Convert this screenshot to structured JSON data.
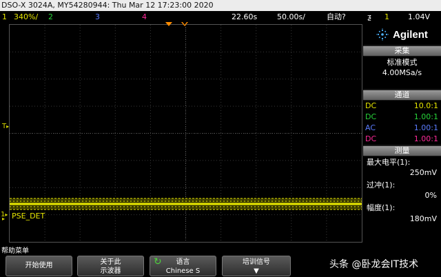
{
  "title": "DSO-X 3024A, MY54280944: Thu Mar 12 17:23:00 2020",
  "status": {
    "ch1_num": "1",
    "ch1_scale": "340%/",
    "ch2_num": "2",
    "ch3_num": "3",
    "ch4_num": "4",
    "time_pos": "22.60s",
    "time_scale": "50.00s/",
    "trigger_mode": "自动?",
    "trigger_icon": "ƺ",
    "trigger_src": "1",
    "trigger_level": "1.04V"
  },
  "screen": {
    "trigger_marker": "T",
    "ch1_marker": "1",
    "signal_label": "PSE_DET"
  },
  "panel": {
    "logo": "Agilent",
    "acq_title": "采集",
    "acq_mode": "标准模式",
    "acq_rate": "4.00MSa/s",
    "chan_title": "通道",
    "channels": [
      {
        "coupling": "DC",
        "ratio": "10.0:1",
        "color": "#e8e800"
      },
      {
        "coupling": "DC",
        "ratio": "1.00:1",
        "color": "#27d63a"
      },
      {
        "coupling": "AC",
        "ratio": "1.00:1",
        "color": "#5b7cff"
      },
      {
        "coupling": "DC",
        "ratio": "1.00:1",
        "color": "#ff2a9a"
      }
    ],
    "meas_title": "测量",
    "meas": [
      {
        "label": "最大电平(1):",
        "value": "250mV"
      },
      {
        "label": "过冲(1):",
        "value": "0%"
      },
      {
        "label": "幅度(1):",
        "value": "180mV"
      }
    ]
  },
  "softkeys": {
    "menu_label": "帮助菜单",
    "key1": "开始使用",
    "key2_line1": "关于此",
    "key2_line2": "示波器",
    "key3_line1": "语言",
    "key3_line2": "Chinese S",
    "key4_line1": "培训信号",
    "key4_arrow": "▼"
  },
  "watermark": "头条 @卧龙会IT技术",
  "colors": {
    "ch1": "#e8e800",
    "ch2": "#27d63a",
    "ch3": "#5b7cff",
    "ch4": "#ff2a9a",
    "trigger_marker": "#ff8c00"
  }
}
